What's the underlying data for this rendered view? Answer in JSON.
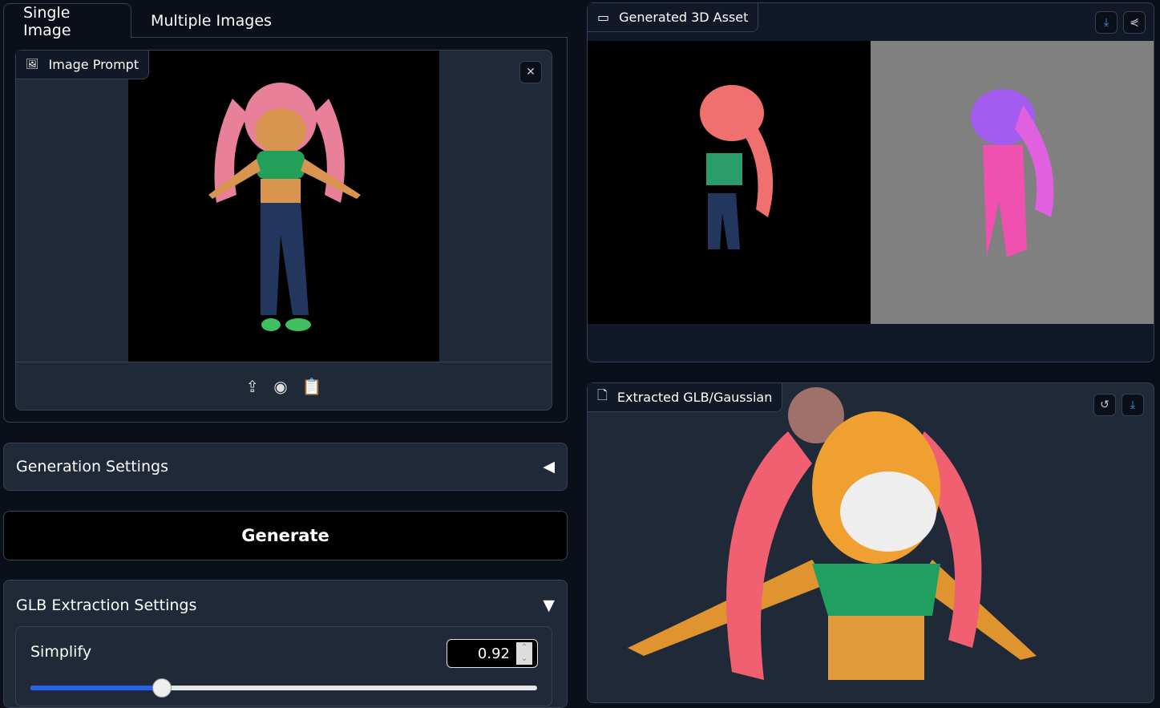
{
  "tabs": [
    {
      "label": "Single Image",
      "active": true
    },
    {
      "label": "Multiple Images",
      "active": false
    }
  ],
  "image_prompt": {
    "label": "Image Prompt",
    "icons": [
      "upload-icon",
      "webcam-icon",
      "clipboard-icon"
    ]
  },
  "generation_settings": {
    "label": "Generation Settings",
    "state": "collapsed"
  },
  "generate_button": {
    "label": "Generate"
  },
  "glb_settings": {
    "label": "GLB Extraction Settings",
    "state": "expanded",
    "simplify": {
      "label": "Simplify",
      "value": "0.92",
      "slider_fraction": 0.26
    }
  },
  "generated_asset": {
    "label": "Generated 3D Asset"
  },
  "extracted": {
    "label": "Extracted GLB/Gaussian"
  },
  "colors": {
    "accent": "#2563eb",
    "panel": "#1f2937",
    "background": "#0b0f19"
  }
}
